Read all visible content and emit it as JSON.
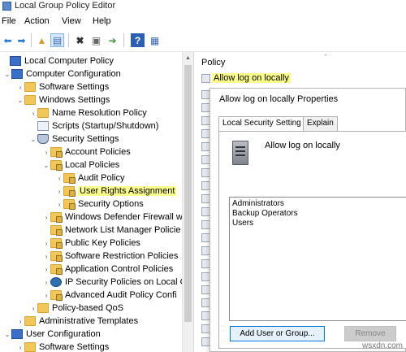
{
  "app": {
    "title": "Local Group Policy Editor"
  },
  "menu": [
    "File",
    "Action",
    "View",
    "Help"
  ],
  "toolbar": {
    "icons": [
      "back-icon",
      "forward-icon",
      "up-folder-icon",
      "show-hide-tree-icon",
      "delete-icon",
      "properties-icon",
      "export-icon",
      "help-icon",
      "console-icon"
    ]
  },
  "tree": {
    "items": [
      {
        "label": "Local Computer Policy",
        "icon": "computer-policy-icon",
        "exp": ""
      },
      {
        "label": "Computer Configuration",
        "icon": "computer-icon",
        "exp": "⌄"
      },
      {
        "label": "Software Settings",
        "icon": "folder-icon",
        "exp": "›"
      },
      {
        "label": "Windows Settings",
        "icon": "folder-icon",
        "exp": "⌄"
      },
      {
        "label": "Name Resolution Policy",
        "icon": "folder-icon",
        "exp": "›"
      },
      {
        "label": "Scripts (Startup/Shutdown)",
        "icon": "doc-icon",
        "exp": ""
      },
      {
        "label": "Security Settings",
        "icon": "shield-icon",
        "exp": "⌄"
      },
      {
        "label": "Account Policies",
        "icon": "folder-lock-icon",
        "exp": "›"
      },
      {
        "label": "Local Policies",
        "icon": "folder-lock-icon",
        "exp": "⌄"
      },
      {
        "label": "Audit Policy",
        "icon": "folder-lock-icon",
        "exp": "›"
      },
      {
        "label": "User Rights Assignment",
        "icon": "folder-lock-icon",
        "exp": "›"
      },
      {
        "label": "Security Options",
        "icon": "folder-lock-icon",
        "exp": "›"
      },
      {
        "label": "Windows Defender Firewall w",
        "icon": "folder-lock-icon",
        "exp": "›"
      },
      {
        "label": "Network List Manager Policie",
        "icon": "folder-lock-icon",
        "exp": ""
      },
      {
        "label": "Public Key Policies",
        "icon": "folder-lock-icon",
        "exp": "›"
      },
      {
        "label": "Software Restriction Policies",
        "icon": "folder-lock-icon",
        "exp": "›"
      },
      {
        "label": "Application Control Policies",
        "icon": "folder-lock-icon",
        "exp": "›"
      },
      {
        "label": "IP Security Policies on Local C",
        "icon": "ipsec-icon",
        "exp": "›"
      },
      {
        "label": "Advanced Audit Policy Confi",
        "icon": "folder-lock-icon",
        "exp": "›"
      },
      {
        "label": "Policy-based QoS",
        "icon": "folder-icon",
        "exp": "›"
      },
      {
        "label": "Administrative Templates",
        "icon": "folder-icon",
        "exp": "›"
      },
      {
        "label": "User Configuration",
        "icon": "user-icon",
        "exp": "⌄"
      },
      {
        "label": "Software Settings",
        "icon": "folder-icon",
        "exp": "›"
      }
    ],
    "selected_label": "User Rights Assignment"
  },
  "right": {
    "header": "Policy",
    "first_item": "Allow log on locally"
  },
  "dialog": {
    "title": "Allow log on locally Properties",
    "tabs": [
      "Local Security Setting",
      "Explain"
    ],
    "policy_name": "Allow log on locally",
    "members": [
      "Administrators",
      "Backup Operators",
      "Users"
    ],
    "add_button": "Add User or Group...",
    "remove_button": "Remove"
  },
  "watermark": "wsxdn.com",
  "colors": {
    "highlight": "#fbff8a",
    "accent": "#0078d7"
  }
}
